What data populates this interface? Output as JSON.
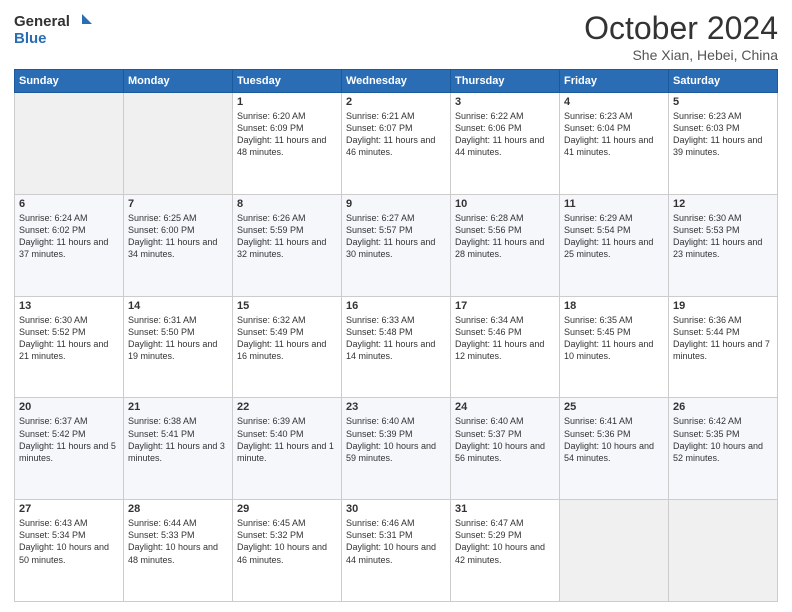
{
  "header": {
    "logo_general": "General",
    "logo_blue": "Blue",
    "month": "October 2024",
    "location": "She Xian, Hebei, China"
  },
  "weekdays": [
    "Sunday",
    "Monday",
    "Tuesday",
    "Wednesday",
    "Thursday",
    "Friday",
    "Saturday"
  ],
  "weeks": [
    [
      {
        "day": "",
        "empty": true
      },
      {
        "day": "",
        "empty": true
      },
      {
        "day": "1",
        "sunrise": "6:20 AM",
        "sunset": "6:09 PM",
        "daylight": "11 hours and 48 minutes."
      },
      {
        "day": "2",
        "sunrise": "6:21 AM",
        "sunset": "6:07 PM",
        "daylight": "11 hours and 46 minutes."
      },
      {
        "day": "3",
        "sunrise": "6:22 AM",
        "sunset": "6:06 PM",
        "daylight": "11 hours and 44 minutes."
      },
      {
        "day": "4",
        "sunrise": "6:23 AM",
        "sunset": "6:04 PM",
        "daylight": "11 hours and 41 minutes."
      },
      {
        "day": "5",
        "sunrise": "6:23 AM",
        "sunset": "6:03 PM",
        "daylight": "11 hours and 39 minutes."
      }
    ],
    [
      {
        "day": "6",
        "sunrise": "6:24 AM",
        "sunset": "6:02 PM",
        "daylight": "11 hours and 37 minutes."
      },
      {
        "day": "7",
        "sunrise": "6:25 AM",
        "sunset": "6:00 PM",
        "daylight": "11 hours and 34 minutes."
      },
      {
        "day": "8",
        "sunrise": "6:26 AM",
        "sunset": "5:59 PM",
        "daylight": "11 hours and 32 minutes."
      },
      {
        "day": "9",
        "sunrise": "6:27 AM",
        "sunset": "5:57 PM",
        "daylight": "11 hours and 30 minutes."
      },
      {
        "day": "10",
        "sunrise": "6:28 AM",
        "sunset": "5:56 PM",
        "daylight": "11 hours and 28 minutes."
      },
      {
        "day": "11",
        "sunrise": "6:29 AM",
        "sunset": "5:54 PM",
        "daylight": "11 hours and 25 minutes."
      },
      {
        "day": "12",
        "sunrise": "6:30 AM",
        "sunset": "5:53 PM",
        "daylight": "11 hours and 23 minutes."
      }
    ],
    [
      {
        "day": "13",
        "sunrise": "6:30 AM",
        "sunset": "5:52 PM",
        "daylight": "11 hours and 21 minutes."
      },
      {
        "day": "14",
        "sunrise": "6:31 AM",
        "sunset": "5:50 PM",
        "daylight": "11 hours and 19 minutes."
      },
      {
        "day": "15",
        "sunrise": "6:32 AM",
        "sunset": "5:49 PM",
        "daylight": "11 hours and 16 minutes."
      },
      {
        "day": "16",
        "sunrise": "6:33 AM",
        "sunset": "5:48 PM",
        "daylight": "11 hours and 14 minutes."
      },
      {
        "day": "17",
        "sunrise": "6:34 AM",
        "sunset": "5:46 PM",
        "daylight": "11 hours and 12 minutes."
      },
      {
        "day": "18",
        "sunrise": "6:35 AM",
        "sunset": "5:45 PM",
        "daylight": "11 hours and 10 minutes."
      },
      {
        "day": "19",
        "sunrise": "6:36 AM",
        "sunset": "5:44 PM",
        "daylight": "11 hours and 7 minutes."
      }
    ],
    [
      {
        "day": "20",
        "sunrise": "6:37 AM",
        "sunset": "5:42 PM",
        "daylight": "11 hours and 5 minutes."
      },
      {
        "day": "21",
        "sunrise": "6:38 AM",
        "sunset": "5:41 PM",
        "daylight": "11 hours and 3 minutes."
      },
      {
        "day": "22",
        "sunrise": "6:39 AM",
        "sunset": "5:40 PM",
        "daylight": "11 hours and 1 minute."
      },
      {
        "day": "23",
        "sunrise": "6:40 AM",
        "sunset": "5:39 PM",
        "daylight": "10 hours and 59 minutes."
      },
      {
        "day": "24",
        "sunrise": "6:40 AM",
        "sunset": "5:37 PM",
        "daylight": "10 hours and 56 minutes."
      },
      {
        "day": "25",
        "sunrise": "6:41 AM",
        "sunset": "5:36 PM",
        "daylight": "10 hours and 54 minutes."
      },
      {
        "day": "26",
        "sunrise": "6:42 AM",
        "sunset": "5:35 PM",
        "daylight": "10 hours and 52 minutes."
      }
    ],
    [
      {
        "day": "27",
        "sunrise": "6:43 AM",
        "sunset": "5:34 PM",
        "daylight": "10 hours and 50 minutes."
      },
      {
        "day": "28",
        "sunrise": "6:44 AM",
        "sunset": "5:33 PM",
        "daylight": "10 hours and 48 minutes."
      },
      {
        "day": "29",
        "sunrise": "6:45 AM",
        "sunset": "5:32 PM",
        "daylight": "10 hours and 46 minutes."
      },
      {
        "day": "30",
        "sunrise": "6:46 AM",
        "sunset": "5:31 PM",
        "daylight": "10 hours and 44 minutes."
      },
      {
        "day": "31",
        "sunrise": "6:47 AM",
        "sunset": "5:29 PM",
        "daylight": "10 hours and 42 minutes."
      },
      {
        "day": "",
        "empty": true
      },
      {
        "day": "",
        "empty": true
      }
    ]
  ]
}
